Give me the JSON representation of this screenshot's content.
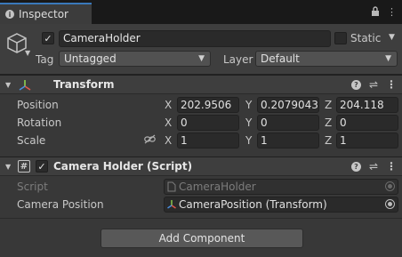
{
  "window": {
    "tab_label": "Inspector",
    "tab_icon": "info-icon",
    "lock_icon": "lock-icon",
    "menu_icon": "kebab-menu-icon"
  },
  "object": {
    "icon": "gameobject-cube-icon",
    "active": true,
    "name": "CameraHolder",
    "static_label": "Static",
    "static_checked": false,
    "tag_label": "Tag",
    "tag_value": "Untagged",
    "layer_label": "Layer",
    "layer_value": "Default"
  },
  "transform": {
    "title": "Transform",
    "icon": "transform-axes-icon",
    "rows": {
      "position": {
        "label": "Position",
        "x": "202.9506",
        "y": "0.2079043",
        "z": "204.118"
      },
      "rotation": {
        "label": "Rotation",
        "x": "0",
        "y": "0",
        "z": "0"
      },
      "scale": {
        "label": "Scale",
        "x": "1",
        "y": "1",
        "z": "1",
        "link_icon": "constrain-proportions-icon"
      }
    },
    "axis_labels": {
      "x": "X",
      "y": "Y",
      "z": "Z"
    }
  },
  "script_component": {
    "title": "Camera Holder (Script)",
    "icon": "csharp-script-icon",
    "enabled": true,
    "script_label": "Script",
    "script_value": "CameraHolder",
    "camera_position_label": "Camera Position",
    "camera_position_value": "CameraPosition (Transform)"
  },
  "add_component_label": "Add Component",
  "colors": {
    "accent": "#3a79bb",
    "background": "#383838",
    "header": "#3e3e3e",
    "field": "#2a2a2a"
  }
}
